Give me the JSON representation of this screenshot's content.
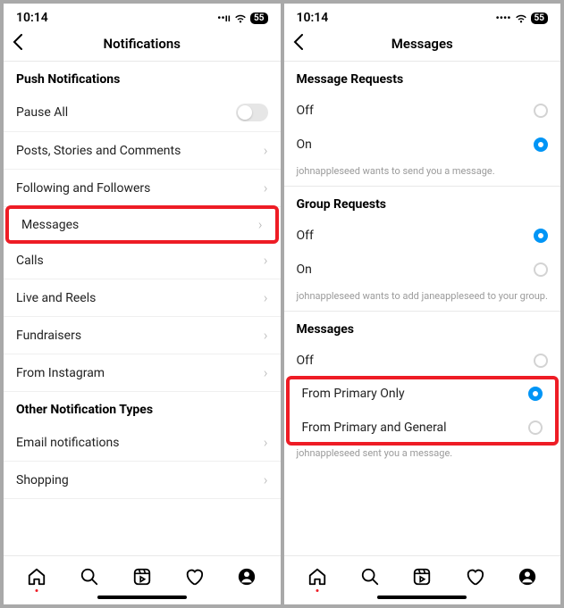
{
  "status": {
    "time": "10:14",
    "battery": "55"
  },
  "left": {
    "title": "Notifications",
    "section1": "Push Notifications",
    "pauseAll": "Pause All",
    "items": {
      "posts": "Posts, Stories and Comments",
      "following": "Following and Followers",
      "messages": "Messages",
      "calls": "Calls",
      "live": "Live and Reels",
      "fundraisers": "Fundraisers",
      "fromIg": "From Instagram"
    },
    "section2": "Other Notification Types",
    "email": "Email notifications",
    "shopping": "Shopping"
  },
  "right": {
    "title": "Messages",
    "section1": "Message Requests",
    "off": "Off",
    "on": "On",
    "example1": "johnappleseed wants to send you a message.",
    "section2": "Group Requests",
    "example2": "johnappleseed wants to add janeappleseed to your group.",
    "section3": "Messages",
    "primaryOnly": "From Primary Only",
    "primaryGeneral": "From Primary and General",
    "example3": "johnappleseed sent you a message."
  }
}
